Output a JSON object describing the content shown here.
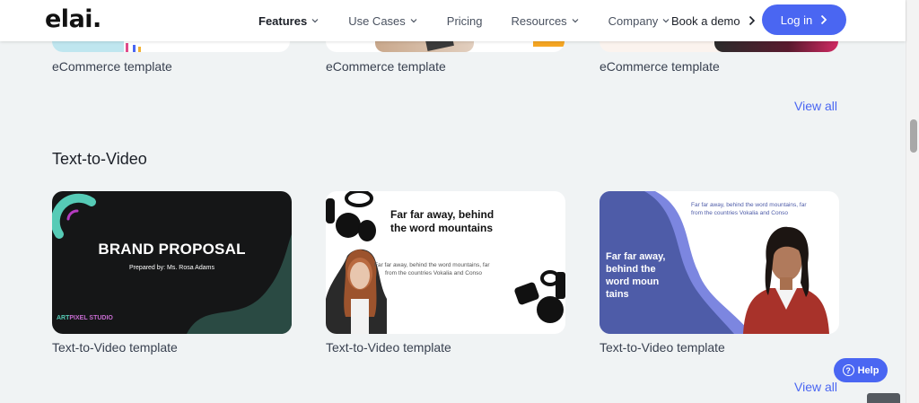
{
  "brand": {
    "logo": "elai."
  },
  "nav": {
    "items": [
      {
        "label": "Features",
        "active": true,
        "dropdown": true
      },
      {
        "label": "Use Cases",
        "active": false,
        "dropdown": true
      },
      {
        "label": "Pricing",
        "active": false,
        "dropdown": false
      },
      {
        "label": "Resources",
        "active": false,
        "dropdown": true
      },
      {
        "label": "Company",
        "active": false,
        "dropdown": true
      }
    ],
    "book_demo": "Book a demo",
    "login": "Log in"
  },
  "ecommerce": {
    "cards": [
      {
        "caption": "eCommerce template"
      },
      {
        "caption": "eCommerce template"
      },
      {
        "caption": "eCommerce template"
      }
    ],
    "view_all": "View all"
  },
  "text_to_video": {
    "title": "Text-to-Video",
    "cards": [
      {
        "caption": "Text-to-Video template",
        "heading": "BRAND PROPOSAL",
        "subheading": "Prepared by: Ms. Rosa Adams",
        "brand_a": "ART",
        "brand_b": "PIXEL STUDIO"
      },
      {
        "caption": "Text-to-Video template",
        "heading_line1": "Far far away, behind",
        "heading_line2": "the word mountains",
        "body_line1": "Far far away, behind the word mountains, far",
        "body_line2": "from the countries Vokalia and Conso"
      },
      {
        "caption": "Text-to-Video template",
        "heading_line1": "Far far away,",
        "heading_line2": "behind the",
        "heading_line3": "word moun",
        "heading_line4": "tains",
        "body_line1": "Far far away, behind the word mountains, far",
        "body_line2": "from the countries Vokalia and Conso"
      }
    ],
    "view_all": "View all"
  },
  "help": {
    "label": "Help",
    "icon": "?"
  },
  "colors": {
    "accent": "#4a66f2",
    "background": "#f0f3f4",
    "dark_card": "#151617",
    "purple_card": "#4e5ca8"
  }
}
